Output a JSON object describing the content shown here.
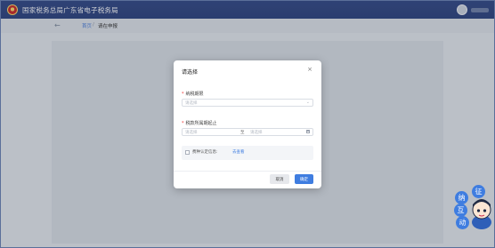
{
  "header": {
    "title": "国家税务总局广东省电子税务局"
  },
  "breadcrumb": {
    "back_icon": "back-arrow-icon",
    "home": "首页",
    "separator": "/",
    "current": "请在申报"
  },
  "modal": {
    "title": "请选择",
    "close_icon": "close-icon",
    "fields": [
      {
        "label": "纳税期限",
        "required": true,
        "placeholder": "请选择"
      },
      {
        "label": "税款所属期起止",
        "required": true,
        "start_placeholder": "请选择",
        "separator": "至",
        "end_placeholder": "请选择"
      }
    ],
    "notice": {
      "text": "费种认定信息:",
      "link": "去查看"
    },
    "buttons": {
      "cancel": "取消",
      "confirm": "确定"
    }
  },
  "assistant": {
    "chars": [
      "征",
      "纳",
      "互",
      "动"
    ]
  },
  "colors": {
    "header_bg": "#2e447e",
    "primary": "#3f7de0",
    "required": "#e33333"
  }
}
